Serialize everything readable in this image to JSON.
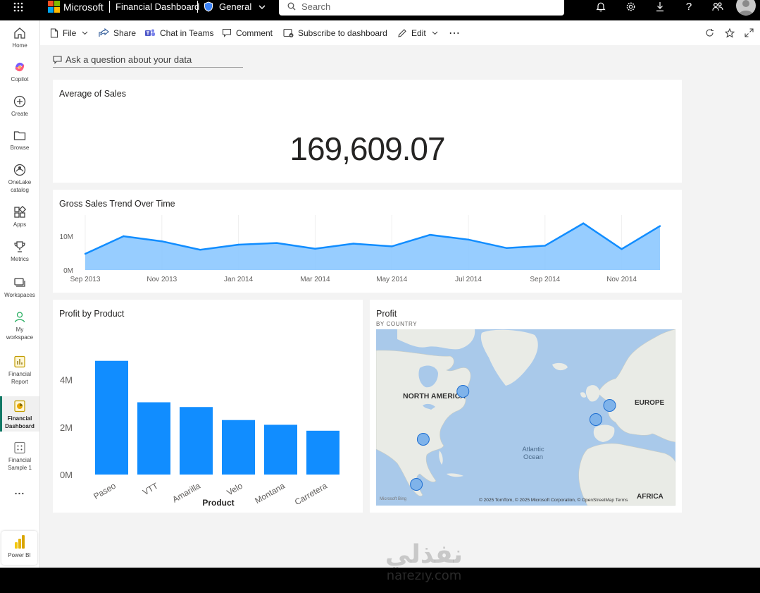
{
  "topbar": {
    "brand": "Microsoft",
    "report_name": "Financial Dashboard",
    "workspace": "General",
    "search_placeholder": "Search"
  },
  "nav": {
    "items": [
      {
        "label": "Home",
        "icon": "home-icon"
      },
      {
        "label": "Copilot",
        "icon": "copilot-icon"
      },
      {
        "label": "Create",
        "icon": "plus-circle-icon"
      },
      {
        "label": "Browse",
        "icon": "folder-icon"
      },
      {
        "label": "OneLake catalog",
        "icon": "onelake-icon"
      },
      {
        "label": "Apps",
        "icon": "apps-icon"
      },
      {
        "label": "Metrics",
        "icon": "trophy-icon"
      },
      {
        "label": "Workspaces",
        "icon": "workspaces-icon"
      },
      {
        "label": "My workspace",
        "icon": "person-icon"
      },
      {
        "label": "Financial Report",
        "icon": "report-icon"
      },
      {
        "label": "Financial Dashboard",
        "icon": "dashboard-icon"
      },
      {
        "label": "Financial Sample 1",
        "icon": "semantic-model-icon"
      }
    ],
    "more": "...",
    "product": "Power BI"
  },
  "toolbar": {
    "file": "File",
    "share": "Share",
    "chat": "Chat in Teams",
    "comment": "Comment",
    "subscribe": "Subscribe to dashboard",
    "edit": "Edit",
    "more": "⋯"
  },
  "qna": {
    "placeholder": "Ask a question about your data"
  },
  "tiles": {
    "kpi": {
      "title": "Average of Sales",
      "value": "169,609.07"
    },
    "trend": {
      "title": "Gross Sales Trend Over Time"
    },
    "profit_by_product": {
      "title": "Profit by Product"
    },
    "map": {
      "title": "Profit",
      "subtitle": "BY COUNTRY",
      "labels": {
        "north_america": "NORTH AMERICA",
        "europe": "EUROPE",
        "africa": "AFRICA",
        "ocean": "Atlantic Ocean"
      },
      "bing": "Microsoft Bing",
      "attribution": "© 2025 TomTom, © 2025 Microsoft Corporation, © OpenStreetMap  Terms",
      "bubbles": [
        {
          "name": "Canada",
          "lon": -75,
          "lat": 56
        },
        {
          "name": "United States of America",
          "lon": -98,
          "lat": 39
        },
        {
          "name": "Mexico",
          "lon": -102,
          "lat": 23
        },
        {
          "name": "Germany",
          "lon": 10,
          "lat": 51
        },
        {
          "name": "France",
          "lon": 2,
          "lat": 46
        }
      ]
    }
  },
  "chart_data": [
    {
      "type": "area",
      "title": "Gross Sales Trend Over Time",
      "x": [
        "Sep 2013",
        "Oct 2013",
        "Nov 2013",
        "Dec 2013",
        "Jan 2014",
        "Feb 2014",
        "Mar 2014",
        "Apr 2014",
        "May 2014",
        "Jun 2014",
        "Jul 2014",
        "Aug 2014",
        "Sep 2014",
        "Oct 2014",
        "Nov 2014",
        "Dec 2014"
      ],
      "x_tick_labels": [
        "Sep 2013",
        "Nov 2013",
        "Jan 2014",
        "Mar 2014",
        "May 2014",
        "Jul 2014",
        "Sep 2014",
        "Nov 2014"
      ],
      "values": [
        4.8,
        10.0,
        8.5,
        6.0,
        7.5,
        8.0,
        6.3,
        7.8,
        7.0,
        10.4,
        9.0,
        6.5,
        7.2,
        13.8,
        6.2,
        13.0
      ],
      "unit": "M",
      "y_tick_labels": [
        "0M",
        "10M"
      ],
      "ylim": [
        0,
        15
      ],
      "grid": true,
      "color": "#118DFF"
    },
    {
      "type": "bar",
      "title": "Profit by Product",
      "xlabel": "Product",
      "categories": [
        "Paseo",
        "VTT",
        "Amarilla",
        "Velo",
        "Montana",
        "Carretera"
      ],
      "values": [
        4.8,
        3.05,
        2.85,
        2.3,
        2.1,
        1.85
      ],
      "unit": "M",
      "y_tick_labels": [
        "0M",
        "2M",
        "4M"
      ],
      "ylim": [
        0,
        5
      ],
      "color": "#118DFF"
    }
  ],
  "watermark": {
    "arabic": "نفذلي",
    "latin": "nafezly.com"
  }
}
